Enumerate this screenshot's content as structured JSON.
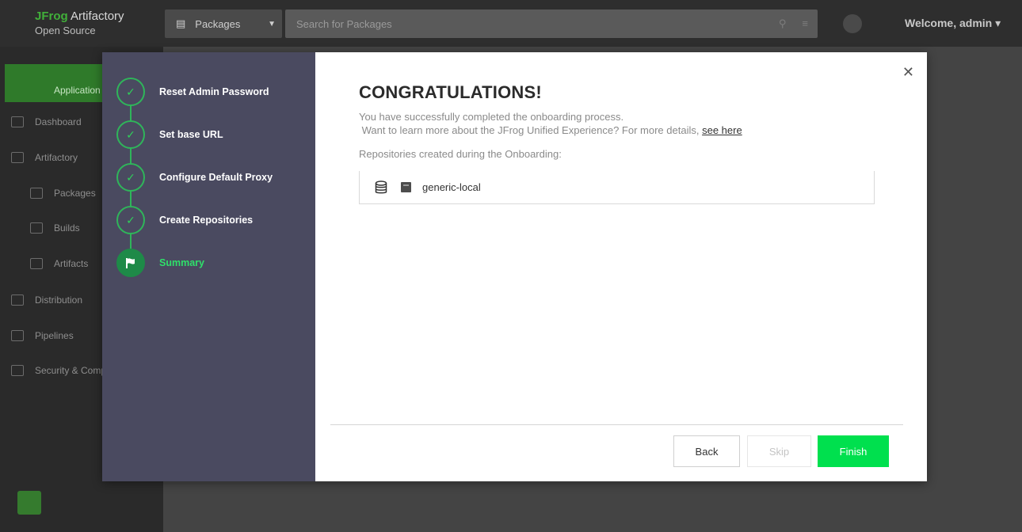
{
  "app": {
    "brand_prefix": "JFrog",
    "brand_name": "Artifactory",
    "edition": "Open Source",
    "packages_select": "Packages",
    "search_placeholder": "Search for Packages",
    "welcome": "Welcome, admin"
  },
  "sidebar": {
    "items": [
      {
        "label": "Application"
      },
      {
        "label": "Dashboard"
      },
      {
        "label": "Artifactory"
      },
      {
        "label": "Packages"
      },
      {
        "label": "Builds"
      },
      {
        "label": "Artifacts"
      },
      {
        "label": "Distribution"
      },
      {
        "label": "Pipelines"
      },
      {
        "label": "Security & Compliance"
      }
    ]
  },
  "wizard": {
    "steps": [
      {
        "label": "Reset Admin Password",
        "status": "done",
        "icon": "check-icon"
      },
      {
        "label": "Set base URL",
        "status": "done",
        "icon": "check-icon"
      },
      {
        "label": "Configure Default Proxy",
        "status": "done",
        "icon": "check-icon"
      },
      {
        "label": "Create Repositories",
        "status": "done",
        "icon": "check-icon"
      },
      {
        "label": "Summary",
        "status": "current",
        "icon": "flag-icon"
      }
    ]
  },
  "summary": {
    "title": "CONGRATULATIONS!",
    "line1": "You have successfully completed the onboarding process.",
    "line2": "Want to learn more about the JFrog Unified Experience? For more details,",
    "link": "see here",
    "repos_label": "Repositories created during the Onboarding:",
    "repos": [
      {
        "name": "generic-local",
        "icon": "package-icon"
      }
    ]
  },
  "footer": {
    "back": "Back",
    "skip": "Skip",
    "finish": "Finish"
  },
  "colors": {
    "accent_green": "#00e04e",
    "wizard_bg": "#4a4a60",
    "step_green": "#2fb55a"
  }
}
